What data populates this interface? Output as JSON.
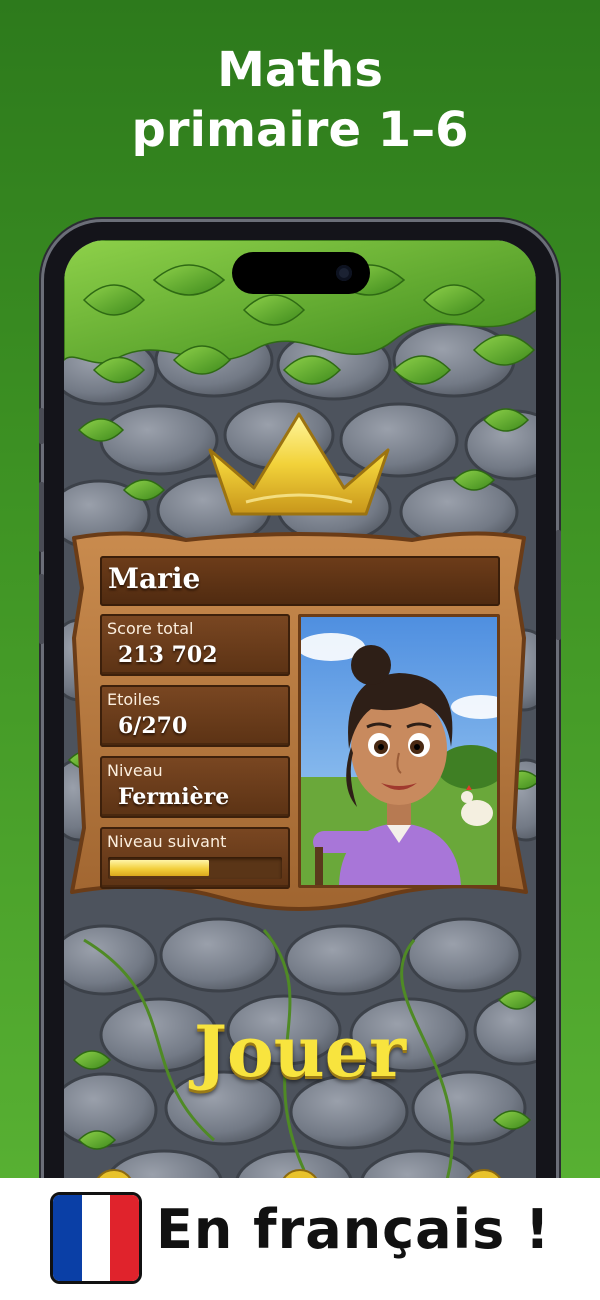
{
  "headline": {
    "line1": "Maths",
    "line2": "primaire 1–6"
  },
  "profile": {
    "name": "Marie",
    "stats": [
      {
        "label": "Score total",
        "value": "213 702"
      },
      {
        "label": "Etoiles",
        "value": "6/270"
      },
      {
        "label": "Niveau",
        "value": "Fermière"
      }
    ],
    "next_level_label": "Niveau suivant",
    "next_level_progress": 0.58
  },
  "play_button_label": "Jouer",
  "banner": {
    "text": "En français !"
  },
  "icons": [
    "crown-icon",
    "avatar",
    "flag-france-icon",
    "settings-icon",
    "menu-icon",
    "help-icon"
  ],
  "colors": {
    "background_green": "#3f9424",
    "wood": "#6e3d1a",
    "play_yellow": "#f8e43e",
    "flag_blue": "#0a3fa6",
    "flag_white": "#ffffff",
    "flag_red": "#e0232c"
  }
}
